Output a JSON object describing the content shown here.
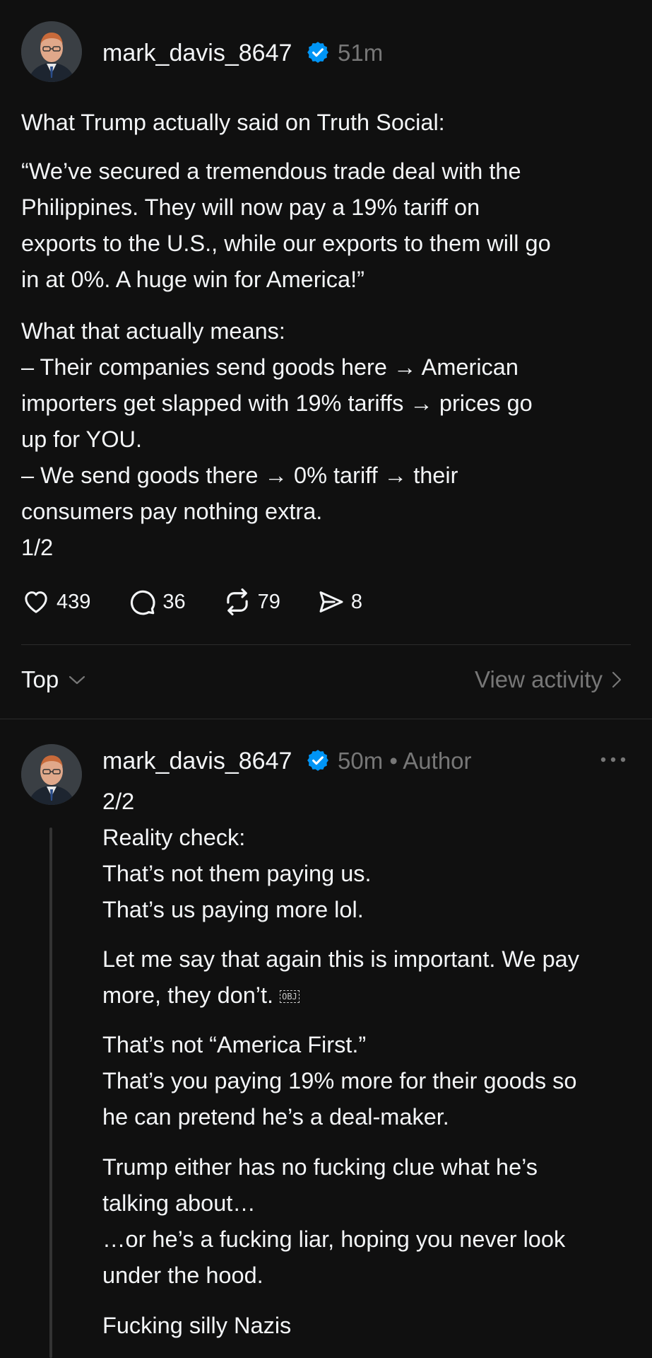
{
  "post": {
    "username": "mark_davis_8647",
    "time": "51m",
    "paragraphs": [
      "What Trump actually said on Truth Social:",
      "“We’ve secured a tremendous trade deal with the\nPhilippines. They will now pay a 19% tariff on\nexports to the U.S., while our exports to them will go\nin at 0%. A huge win for America!”",
      "What that actually means:\n– Their companies send goods here → American\nimporters get slapped with 19% tariffs → prices go\nup for YOU.\n– We send goods there → 0% tariff → their\nconsumers pay nothing extra.\n1/2"
    ],
    "likes": "439",
    "replies": "36",
    "reposts": "79",
    "shares": "8"
  },
  "sort": {
    "label": "Top",
    "view_activity": "View activity"
  },
  "reply": {
    "username": "mark_davis_8647",
    "time": "50m",
    "separator": "•",
    "author_tag": "Author",
    "paragraphs": [
      "2/2\nReality check:\nThat’s not them paying us.\nThat’s us paying more lol.",
      "Let me say that again this is important. We pay\nmore, they don’t. ",
      "That’s not “America First.”\nThat’s you paying 19% more for their goods so\nhe can pretend he’s a deal-maker.",
      "Trump either has no fucking clue what he’s\ntalking about…\n…or he’s a fucking liar, hoping you never look\nunder the hood.",
      "Fucking silly Nazis"
    ],
    "obj_glyph": "OBJ"
  },
  "colors": {
    "background": "#101010",
    "text": "#f3f5f7",
    "muted": "#777777",
    "verified": "#0095f6"
  },
  "icons": [
    "heart-icon",
    "comment-icon",
    "repost-icon",
    "share-icon",
    "verified-badge-icon",
    "chevron-down-icon",
    "chevron-right-icon",
    "more-icon"
  ]
}
